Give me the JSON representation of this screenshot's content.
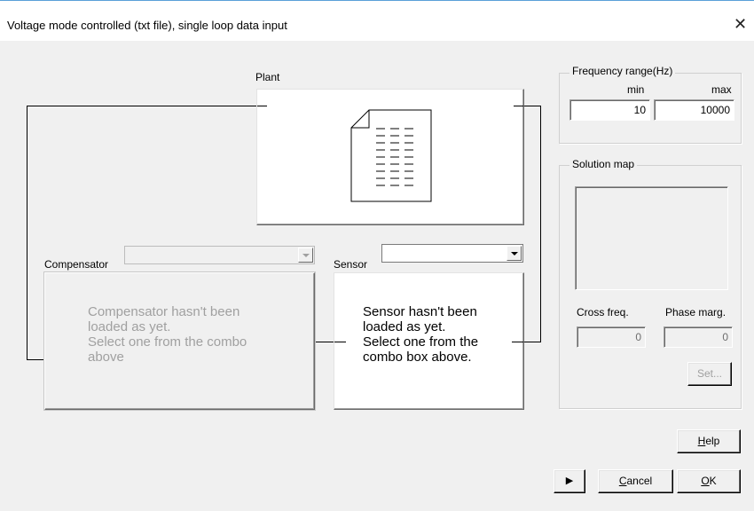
{
  "window": {
    "title": "Voltage mode controlled (txt file), single loop data input",
    "close_glyph": "✕"
  },
  "plant": {
    "label": "Plant",
    "icon": "text-document-icon"
  },
  "compensator": {
    "label": "Compensator",
    "selected": "",
    "message": "Compensator hasn't been\nloaded as yet.\nSelect one from the combo\nabove"
  },
  "sensor": {
    "label": "Sensor",
    "selected": "",
    "message": "Sensor hasn't been\nloaded as yet.\nSelect one from the\ncombo box above."
  },
  "frequency_range": {
    "title": "Frequency range(Hz)",
    "min_label": "min",
    "max_label": "max",
    "min_value": "10",
    "max_value": "10000"
  },
  "solution_map": {
    "title": "Solution map",
    "cross_freq_label": "Cross freq.",
    "phase_marg_label": "Phase marg.",
    "cross_freq_value": "0",
    "phase_marg_value": "0",
    "set_label": "Set..."
  },
  "buttons": {
    "help_u": "H",
    "help_rest": "elp",
    "play_glyph": "▶",
    "cancel_u": "C",
    "cancel_rest": "ancel",
    "ok_u": "O",
    "ok_rest": "K"
  },
  "colors": {
    "dialog_bg": "#f0f0f0",
    "title_border": "#5aa0d8",
    "disabled_text": "#a0a0a0"
  }
}
